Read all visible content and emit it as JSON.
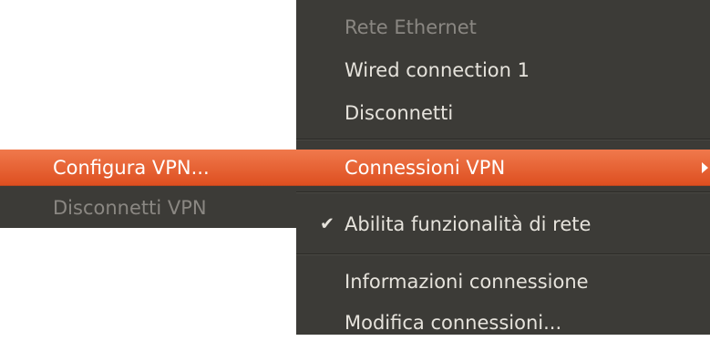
{
  "main_menu": {
    "section_header": "Rete Ethernet",
    "wired_connection": "Wired connection 1",
    "disconnect": "Disconnetti",
    "vpn_connections": "Connessioni VPN",
    "enable_networking": "Abilita funzionalità di rete",
    "enable_networking_checked": true,
    "check_icon": "✔",
    "connection_info": "Informazioni connessione",
    "edit_connections": "Modifica connessioni..."
  },
  "vpn_submenu": {
    "configure_vpn": "Configura VPN...",
    "disconnect_vpn": "Disconnetti VPN"
  },
  "colors": {
    "menu_background": "#3c3b37",
    "highlight": "#e95420",
    "text": "#e6e3dc",
    "disabled_text": "#8a8782"
  },
  "icons": {
    "check": "check-icon",
    "submenu_arrow": "submenu-arrow-icon"
  }
}
